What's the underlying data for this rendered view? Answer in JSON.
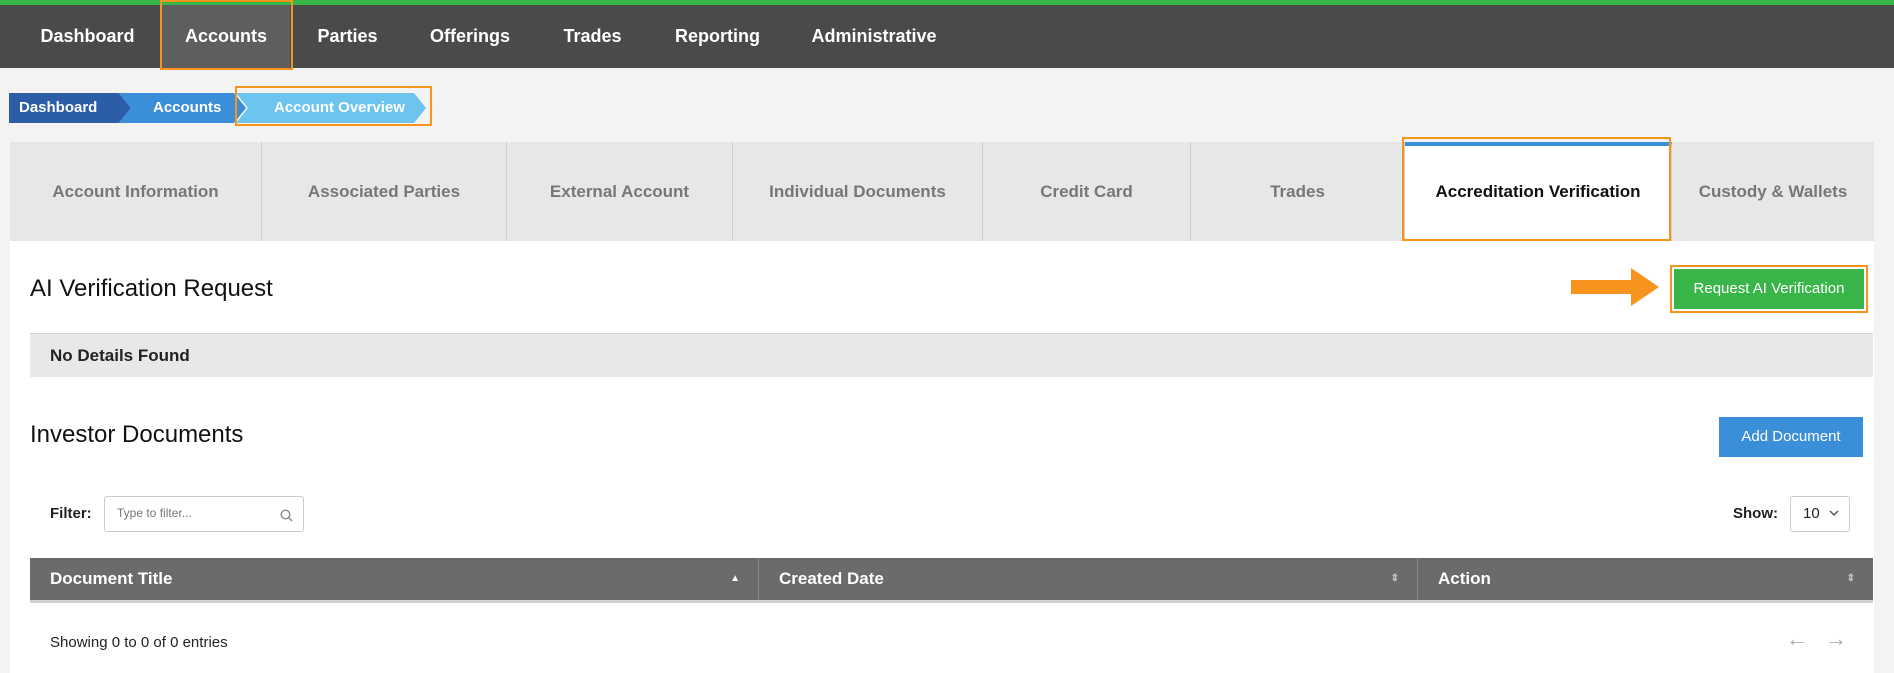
{
  "nav": {
    "items": [
      {
        "label": "Dashboard"
      },
      {
        "label": "Accounts"
      },
      {
        "label": "Parties"
      },
      {
        "label": "Offerings"
      },
      {
        "label": "Trades"
      },
      {
        "label": "Reporting"
      },
      {
        "label": "Administrative"
      }
    ],
    "active": "Accounts"
  },
  "breadcrumb": [
    "Dashboard",
    "Accounts",
    "Account Overview"
  ],
  "tabs": [
    {
      "label": "Account Information"
    },
    {
      "label": "Associated Parties"
    },
    {
      "label": "External Account"
    },
    {
      "label": "Individual Documents"
    },
    {
      "label": "Credit Card"
    },
    {
      "label": "Trades"
    },
    {
      "label": "Accreditation Verification"
    },
    {
      "label": "Custody & Wallets"
    }
  ],
  "active_tab": "Accreditation Verification",
  "ai_section": {
    "title": "AI Verification Request",
    "button_label": "Request AI Verification",
    "empty_text": "No Details Found"
  },
  "docs_section": {
    "title": "Investor Documents",
    "add_button_label": "Add Document",
    "filter_label": "Filter:",
    "filter_placeholder": "Type to filter...",
    "show_label": "Show:",
    "show_value": "10",
    "columns": [
      {
        "label": "Document Title"
      },
      {
        "label": "Created Date"
      },
      {
        "label": "Action"
      }
    ],
    "entries_text": "Showing 0 to 0 of 0 entries",
    "prev_glyph": "←",
    "next_glyph": "→"
  },
  "colors": {
    "nav_bg": "#4a4a4a",
    "accent_green": "#3ab54a",
    "highlight_orange": "#f7941d",
    "primary_blue": "#3a8fd8",
    "crumb_dark": "#2c5ea8",
    "crumb_mid": "#3a8fd8",
    "crumb_light": "#6cc4ef"
  }
}
